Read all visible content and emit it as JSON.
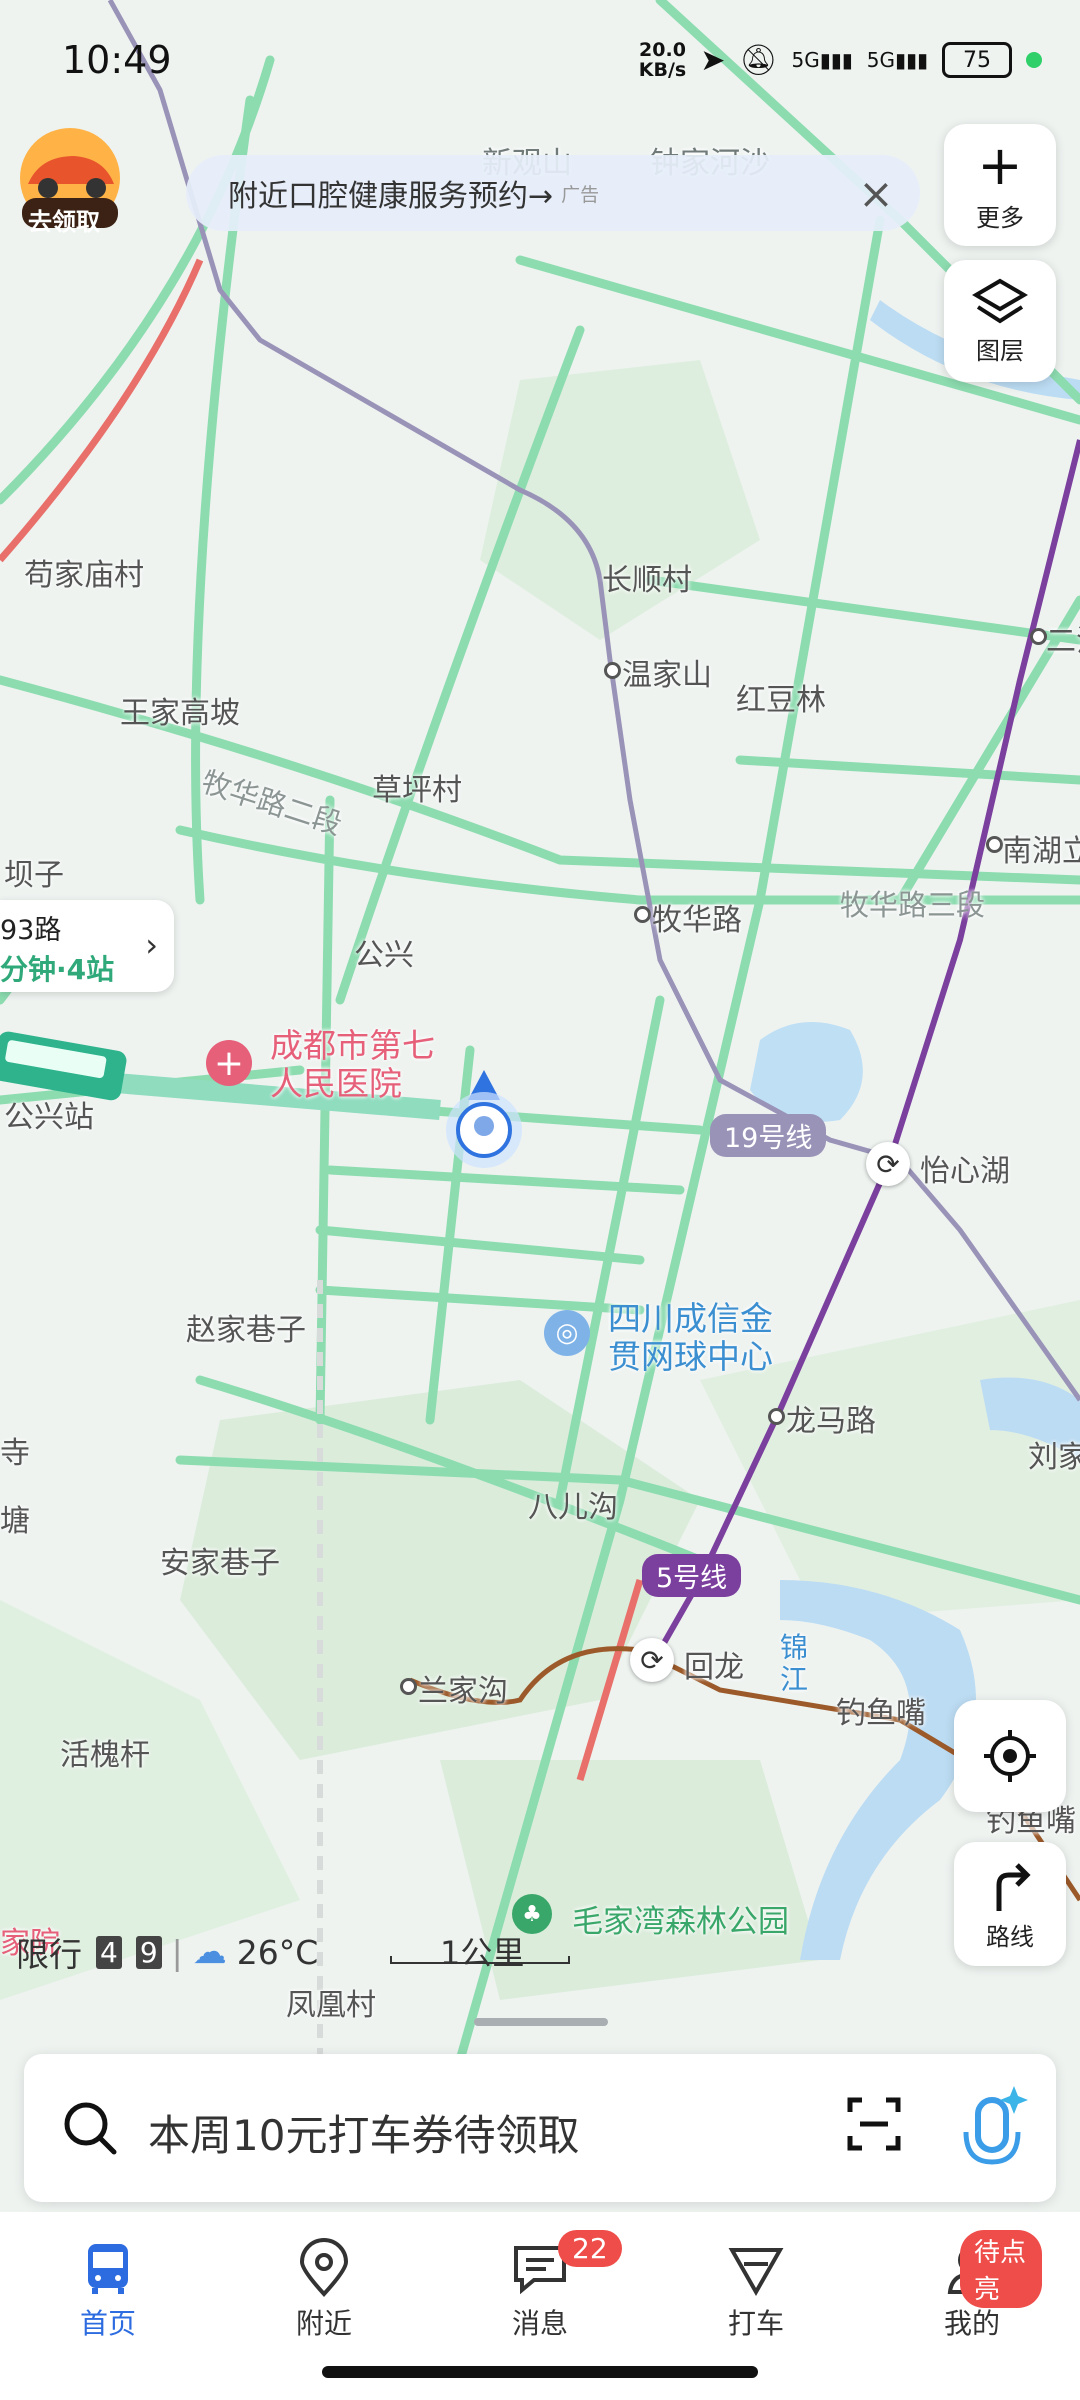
{
  "status_bar": {
    "time": "10:49",
    "net_speed_value": "20.0",
    "net_speed_unit": "KB/s",
    "signal1": "5G",
    "signal2": "5G",
    "battery": "75"
  },
  "promo": {
    "label": "去领取"
  },
  "ad_banner": {
    "text": "附近口腔健康服务预约→",
    "tag": "广告"
  },
  "side_buttons": {
    "more": "更多",
    "layers": "图层",
    "route": "路线"
  },
  "bus_card": {
    "route": "93路",
    "eta": "分钟·4站"
  },
  "map": {
    "labels": {
      "xinguan": "新观山",
      "zhongjia": "钟家河沙",
      "gouji": "苟家庙村",
      "changshun": "长顺村",
      "wenjiashan": "温家山",
      "hongdoulin": "红豆林",
      "wangjia": "王家高坡",
      "muhua_2": "牧华路二段",
      "caoping": "草坪村",
      "bazi": "坝子",
      "gongxing": "公兴",
      "muhua": "牧华路",
      "muhua_3": "牧华路三段",
      "nanhu": "南湖立",
      "er": "二江",
      "gongxing_stn": "公兴站",
      "hospital": "成都市第七\n人民医院",
      "zhaojia": "赵家巷子",
      "tennis": "四川成信金\n贯网球中心",
      "longma": "龙马路",
      "liujia": "刘家",
      "si": "寺",
      "tang": "塘",
      "baer": "八儿沟",
      "anjia": "安家巷子",
      "lanjia": "兰家沟",
      "huilong": "回龙",
      "jinjiang": "锦\n江",
      "diaoyuzui": "钓鱼嘴",
      "huaigan": "活槐杆",
      "maojiawan": "毛家湾森林公园",
      "fenghuang": "凤凰村",
      "yihu": "怡心湖",
      "jiayuan": "家院",
      "dyz2": "钓鱼嘴"
    },
    "lines": {
      "line19": "19号线",
      "line5": "5号线"
    },
    "colors": {
      "line19": "#9a93b8",
      "line5": "#7b3f9e",
      "line_brown": "#9c5a2a",
      "road_green": "#7fd6a5",
      "congestion": "#e86f6a"
    }
  },
  "weather": {
    "restriction_label": "限行",
    "plate1": "4",
    "plate2": "9",
    "temp": "26°C"
  },
  "scale": {
    "label": "1公里"
  },
  "search": {
    "placeholder": "本周10元打车券待领取"
  },
  "tabs": [
    {
      "label": "首页",
      "icon": "bus-icon",
      "active": true
    },
    {
      "label": "附近",
      "icon": "location-pin-icon"
    },
    {
      "label": "消息",
      "icon": "message-icon",
      "badge": "22"
    },
    {
      "label": "打车",
      "icon": "taxi-icon"
    },
    {
      "label": "我的",
      "icon": "profile-icon",
      "badge": "待点亮"
    }
  ]
}
